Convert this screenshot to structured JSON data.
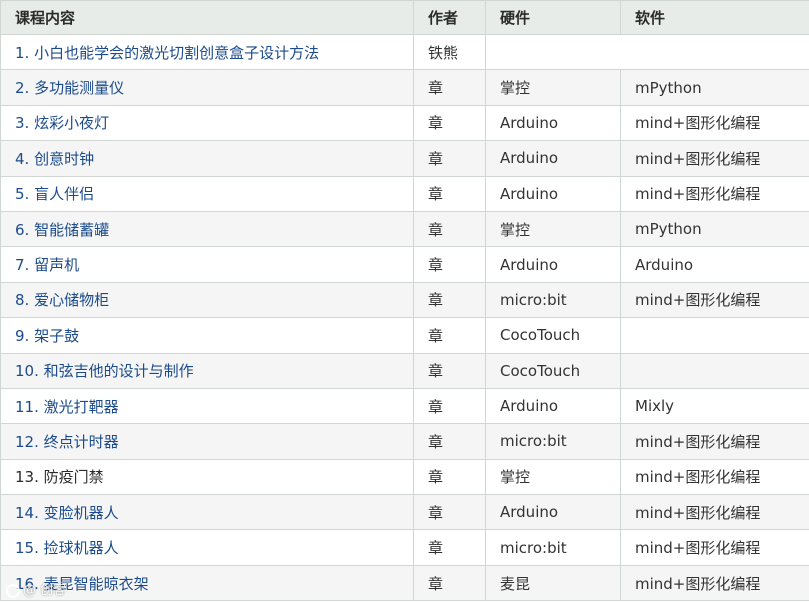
{
  "table": {
    "headers": [
      "课程内容",
      "作者",
      "硬件",
      "软件"
    ],
    "rows": [
      {
        "course": "1. 小白也能学会的激光切割创意盒子设计方法",
        "author": "铁熊",
        "hardware": "",
        "software": "",
        "merged": true,
        "link": true
      },
      {
        "course": "2. 多功能测量仪",
        "author": "章",
        "hardware": "掌控",
        "software": "mPython",
        "link": true
      },
      {
        "course": "3. 炫彩小夜灯",
        "author": "章",
        "hardware": "Arduino",
        "software": "mind+图形化编程",
        "link": true
      },
      {
        "course": "4. 创意时钟",
        "author": "章",
        "hardware": "Arduino",
        "software": "mind+图形化编程",
        "link": true
      },
      {
        "course": "5. 盲人伴侣",
        "author": "章",
        "hardware": "Arduino",
        "software": "mind+图形化编程",
        "link": true
      },
      {
        "course": "6. 智能储蓄罐",
        "author": "章",
        "hardware": "掌控",
        "software": "mPython",
        "link": true
      },
      {
        "course": "7. 留声机",
        "author": "章",
        "hardware": "Arduino",
        "software": "Arduino",
        "link": true
      },
      {
        "course": "8. 爱心储物柜",
        "author": "章",
        "hardware": "micro:bit",
        "software": "mind+图形化编程",
        "link": true
      },
      {
        "course": "9. 架子鼓",
        "author": "章",
        "hardware": "CocoTouch",
        "software": "",
        "link": true
      },
      {
        "course": "10. 和弦吉他的设计与制作",
        "author": "章",
        "hardware": "CocoTouch",
        "software": "",
        "link": true
      },
      {
        "course": "11. 激光打靶器",
        "author": "章",
        "hardware": "Arduino",
        "software": "Mixly",
        "link": true
      },
      {
        "course": "12. 终点计时器",
        "author": "章",
        "hardware": "micro:bit",
        "software": "mind+图形化编程",
        "link": true
      },
      {
        "course": "13. 防疫门禁",
        "author": "章",
        "hardware": "掌控",
        "software": "mind+图形化编程",
        "link": false
      },
      {
        "course": "14. 变脸机器人",
        "author": "章",
        "hardware": "Arduino",
        "software": "mind+图形化编程",
        "link": true
      },
      {
        "course": "15. 捡球机器人",
        "author": "章",
        "hardware": "micro:bit",
        "software": "mind+图形化编程",
        "link": true
      },
      {
        "course": "16. 麦昆智能晾衣架",
        "author": "章",
        "hardware": "麦昆",
        "software": "mind+图形化编程",
        "link": true
      }
    ]
  },
  "watermark": {
    "text": "@ 创客"
  }
}
